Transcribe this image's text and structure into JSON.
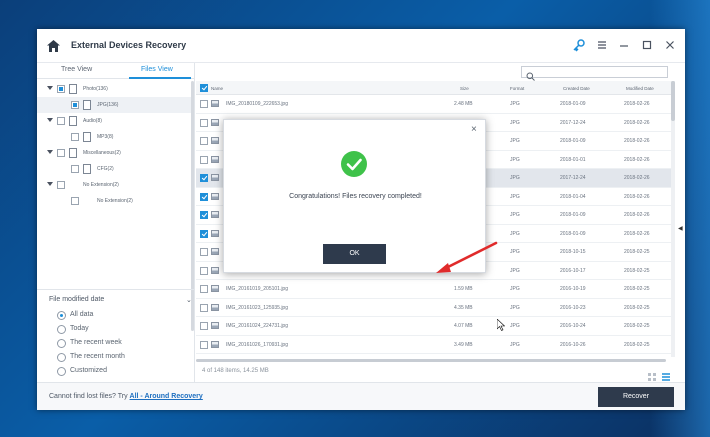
{
  "app": {
    "title": "External Devices Recovery"
  },
  "tabs": [
    {
      "label": "Tree View",
      "active": false
    },
    {
      "label": "Files View",
      "active": true
    }
  ],
  "search": {
    "placeholder": "",
    "value": ""
  },
  "tree": [
    {
      "label": "Photo(136)",
      "level": 0,
      "expanded": true,
      "check": "partial"
    },
    {
      "label": "JPG(136)",
      "level": 1,
      "check": "partial",
      "selected": true
    },
    {
      "label": "Audio(8)",
      "level": 0,
      "expanded": true,
      "check": "none"
    },
    {
      "label": "MP3(8)",
      "level": 1,
      "check": "none"
    },
    {
      "label": "Miscellaneous(2)",
      "level": 0,
      "expanded": true,
      "check": "none"
    },
    {
      "label": "CFG(2)",
      "level": 1,
      "check": "none"
    },
    {
      "label": "No Extension(2)",
      "level": 0,
      "expanded": true,
      "check": "none"
    },
    {
      "label": "No Extension(2)",
      "level": 1,
      "check": "none"
    }
  ],
  "filter": {
    "title": "File modified date",
    "options": [
      {
        "label": "All data",
        "selected": true
      },
      {
        "label": "Today",
        "selected": false
      },
      {
        "label": "The recent week",
        "selected": false
      },
      {
        "label": "The recent month",
        "selected": false
      },
      {
        "label": "Customized",
        "selected": false
      }
    ]
  },
  "table": {
    "columns": {
      "name": "Name",
      "size": "Size",
      "format": "Format",
      "created": "Created Date",
      "modified": "Modified Date"
    },
    "rows": [
      {
        "name": "IMG_20180109_222653.jpg",
        "size": "2.48 MB",
        "format": "JPG",
        "created": "2018-01-09",
        "modified": "2018-02-26",
        "checked": false,
        "selected": false
      },
      {
        "name": "",
        "size": "",
        "format": "JPG",
        "created": "2017-12-24",
        "modified": "2018-02-26",
        "checked": false,
        "selected": false
      },
      {
        "name": "",
        "size": "",
        "format": "JPG",
        "created": "2018-01-09",
        "modified": "2018-02-26",
        "checked": false,
        "selected": false
      },
      {
        "name": "",
        "size": "",
        "format": "JPG",
        "created": "2018-01-01",
        "modified": "2018-02-26",
        "checked": false,
        "selected": false
      },
      {
        "name": "",
        "size": "",
        "format": "JPG",
        "created": "2017-12-24",
        "modified": "2018-02-26",
        "checked": true,
        "selected": true
      },
      {
        "name": "",
        "size": "",
        "format": "JPG",
        "created": "2018-01-04",
        "modified": "2018-02-26",
        "checked": true,
        "selected": false
      },
      {
        "name": "",
        "size": "",
        "format": "JPG",
        "created": "2018-01-09",
        "modified": "2018-02-26",
        "checked": true,
        "selected": false
      },
      {
        "name": "",
        "size": "",
        "format": "JPG",
        "created": "2018-01-09",
        "modified": "2018-02-26",
        "checked": true,
        "selected": false
      },
      {
        "name": "",
        "size": "",
        "format": "JPG",
        "created": "2018-10-15",
        "modified": "2018-02-25",
        "checked": false,
        "selected": false
      },
      {
        "name": "IMG_20161017_164838.jpg",
        "size": "3.48 MB",
        "format": "JPG",
        "created": "2016-10-17",
        "modified": "2018-02-25",
        "checked": false,
        "selected": false
      },
      {
        "name": "IMG_20161019_205101.jpg",
        "size": "1.59 MB",
        "format": "JPG",
        "created": "2016-10-19",
        "modified": "2018-02-25",
        "checked": false,
        "selected": false
      },
      {
        "name": "IMG_20161023_125935.jpg",
        "size": "4.35 MB",
        "format": "JPG",
        "created": "2016-10-23",
        "modified": "2018-02-25",
        "checked": false,
        "selected": false
      },
      {
        "name": "IMG_20161024_224731.jpg",
        "size": "4.07 MB",
        "format": "JPG",
        "created": "2016-10-24",
        "modified": "2018-02-25",
        "checked": false,
        "selected": false
      },
      {
        "name": "IMG_20161026_170931.jpg",
        "size": "3.49 MB",
        "format": "JPG",
        "created": "2016-10-26",
        "modified": "2018-02-25",
        "checked": false,
        "selected": false
      }
    ]
  },
  "status": {
    "text": "4 of 148 items, 14.25 MB"
  },
  "footer": {
    "prompt": "Cannot find lost files? Try",
    "link": "All - Around Recovery",
    "recover_label": "Recover"
  },
  "dialog": {
    "message": "Congratulations! Files recovery completed!",
    "ok_label": "OK",
    "close_glyph": "×"
  },
  "colors": {
    "accent": "#1e8fd9",
    "dark_button": "#2e3a4c",
    "success": "#3fc24a",
    "arrow": "#e02b2b"
  },
  "icons": [
    "home-icon",
    "key-icon",
    "menu-icon",
    "minimize-icon",
    "maximize-icon",
    "close-icon",
    "search-icon",
    "check-icon",
    "image-file-icon",
    "folder-icon"
  ]
}
